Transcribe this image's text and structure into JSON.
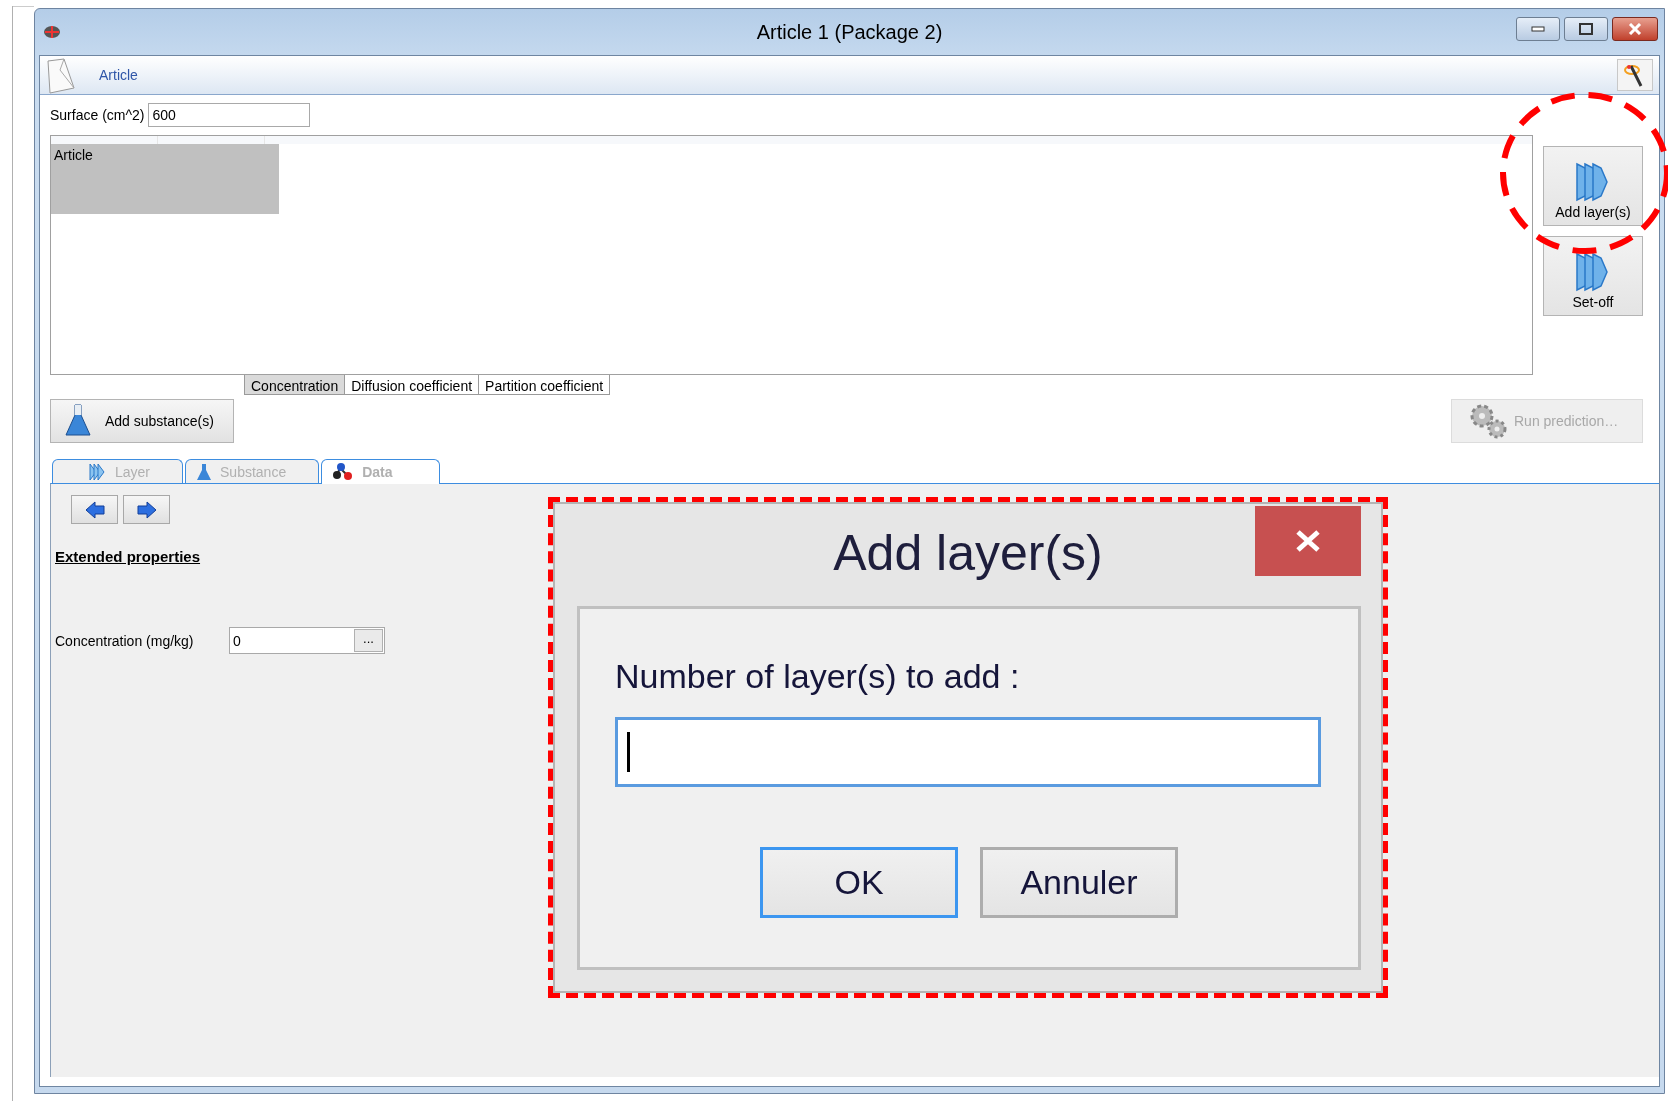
{
  "window": {
    "title": "Article 1 (Package 2)"
  },
  "ribbon": {
    "label": "Article"
  },
  "surface": {
    "label": "Surface (cm^2)",
    "value": "600"
  },
  "grid": {
    "rows": [
      {
        "label": "Article",
        "selected": true
      }
    ]
  },
  "grid_tabs": [
    {
      "label": "Concentration",
      "selected": true
    },
    {
      "label": "Diffusion coefficient",
      "selected": false
    },
    {
      "label": "Partition coefficient",
      "selected": false
    }
  ],
  "side_buttons": [
    {
      "label": "Add layer(s)"
    },
    {
      "label": "Set-off"
    }
  ],
  "add_substance": {
    "label": "Add substance(s)"
  },
  "run_prediction": {
    "label": "Run prediction…",
    "disabled": true
  },
  "panel_tabs": [
    {
      "kind": "layer",
      "label": "Layer",
      "selected": false
    },
    {
      "kind": "substance",
      "label": "Substance",
      "selected": false
    },
    {
      "kind": "data",
      "label": "Data",
      "selected": true
    }
  ],
  "extended": {
    "heading": "Extended properties",
    "fields": [
      {
        "label": "Concentration (mg/kg)",
        "value": "0",
        "button": "..."
      }
    ]
  },
  "dialog": {
    "title": "Add layer(s)",
    "prompt": "Number of layer(s) to add :",
    "buttons": [
      {
        "label": "OK",
        "default": true
      },
      {
        "label": "Annuler",
        "default": false
      }
    ]
  }
}
